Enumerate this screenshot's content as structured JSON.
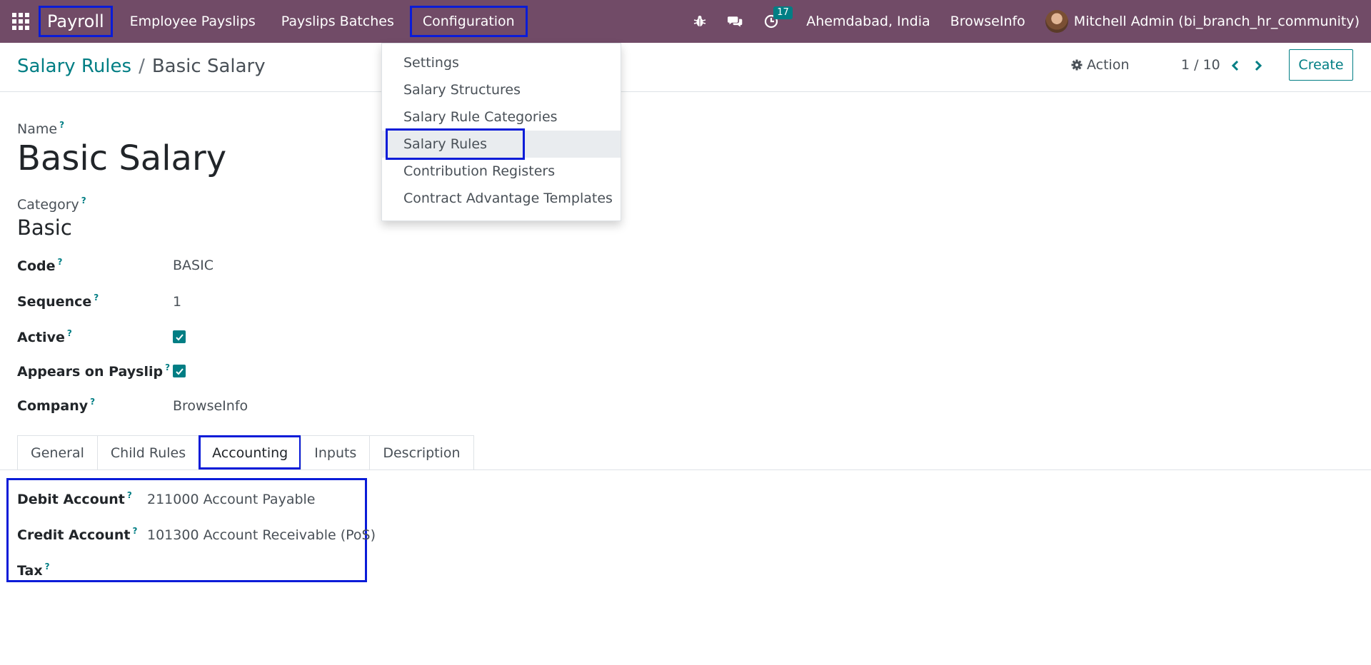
{
  "navbar": {
    "app_name": "Payroll",
    "menu": [
      "Employee Payslips",
      "Payslips Batches",
      "Configuration"
    ],
    "activity_count": "17",
    "location": "Ahemdabad, India",
    "company": "BrowseInfo",
    "user": "Mitchell Admin (bi_branch_hr_community)"
  },
  "breadcrumb": {
    "parent": "Salary Rules",
    "separator": "/",
    "current": "Basic Salary"
  },
  "control": {
    "action_label": "Action",
    "pager": "1 / 10",
    "create_label": "Create"
  },
  "form": {
    "name_label": "Name",
    "name_value": "Basic Salary",
    "category_label": "Category",
    "category_value": "Basic",
    "code_label": "Code",
    "code_value": "BASIC",
    "sequence_label": "Sequence",
    "sequence_value": "1",
    "active_label": "Active",
    "appears_label": "Appears on Payslip",
    "company_label": "Company",
    "company_value": "BrowseInfo",
    "help": "?"
  },
  "tabs": [
    "General",
    "Child Rules",
    "Accounting",
    "Inputs",
    "Description"
  ],
  "accounting": {
    "debit_label": "Debit Account",
    "debit_value": "211000 Account Payable",
    "credit_label": "Credit Account",
    "credit_value": "101300 Account Receivable (PoS)",
    "tax_label": "Tax",
    "tax_value": ""
  },
  "config_menu": {
    "items": [
      "Settings",
      "Salary Structures",
      "Salary Rule Categories",
      "Salary Rules",
      "Contribution Registers",
      "Contract Advantage Templates"
    ],
    "active_index": 3
  },
  "colors": {
    "navbar": "#714b67",
    "accent": "#017e84",
    "highlight_box": "#0a1cd8"
  }
}
